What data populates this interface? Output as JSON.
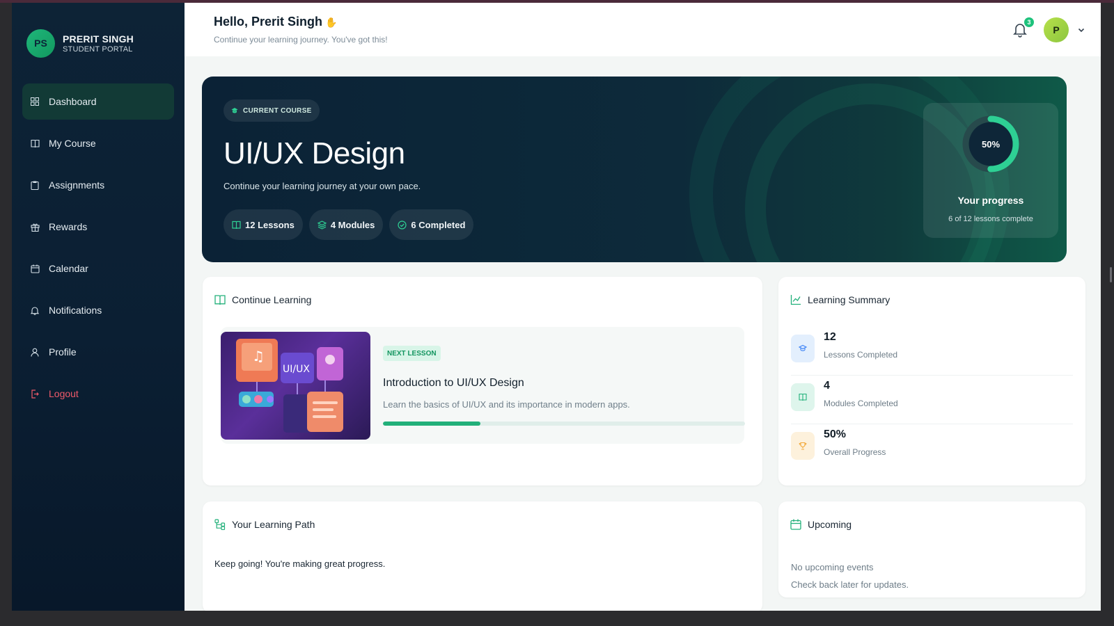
{
  "brand": {
    "initials": "PS",
    "name": "PRERIT SINGH",
    "subtitle": "STUDENT PORTAL"
  },
  "sidebar": {
    "items": [
      {
        "label": "Dashboard",
        "icon": "grid-icon",
        "active": true
      },
      {
        "label": "My Course",
        "icon": "book-icon"
      },
      {
        "label": "Assignments",
        "icon": "clipboard-icon"
      },
      {
        "label": "Rewards",
        "icon": "gift-icon"
      },
      {
        "label": "Calendar",
        "icon": "calendar-icon"
      },
      {
        "label": "Notifications",
        "icon": "bell-icon"
      },
      {
        "label": "Profile",
        "icon": "user-icon"
      },
      {
        "label": "Logout",
        "icon": "logout-icon"
      }
    ]
  },
  "header": {
    "greeting": "Hello, Prerit Singh",
    "subtitle": "Continue your learning journey. You've got this!",
    "notification_count": "3",
    "avatar_initial": "P"
  },
  "hero": {
    "chip": "CURRENT COURSE",
    "title": "UI/UX Design",
    "subtitle": "Continue your learning journey at your own pace.",
    "pills": [
      "12 Lessons",
      "4 Modules",
      "6 Completed"
    ],
    "progress_percent": 50,
    "progress_label": "50%",
    "progress_title": "Your progress",
    "progress_sub": "6 of 12 lessons complete"
  },
  "continue": {
    "title": "Continue Learning",
    "thumb_label": "UI/UX",
    "tag": "NEXT LESSON",
    "lesson_title": "Introduction to UI/UX Design",
    "lesson_desc": "Learn the basics of UI/UX and its importance in modern apps.",
    "progress_fraction": 0.27
  },
  "summary": {
    "title": "Learning Summary",
    "rows": [
      {
        "value": "12",
        "label": "Lessons Completed",
        "icon": "graduation-cap-icon",
        "color": "#3b82f6"
      },
      {
        "value": "4",
        "label": "Modules Completed",
        "icon": "book-icon",
        "color": "#22b07a"
      },
      {
        "value": "50%",
        "label": "Overall Progress",
        "icon": "trophy-icon",
        "color": "#f2a93b"
      }
    ]
  },
  "path": {
    "title": "Your Learning Path",
    "text": "Keep going! You're making great progress."
  },
  "upcoming": {
    "title": "Upcoming",
    "line1": "No upcoming events",
    "line2": "Check back later for updates."
  },
  "colors": {
    "accent": "#22b07a",
    "sidebar_bg": "#0b1f33",
    "hero_bg": "#0b2236",
    "logout": "#f05a6a"
  }
}
